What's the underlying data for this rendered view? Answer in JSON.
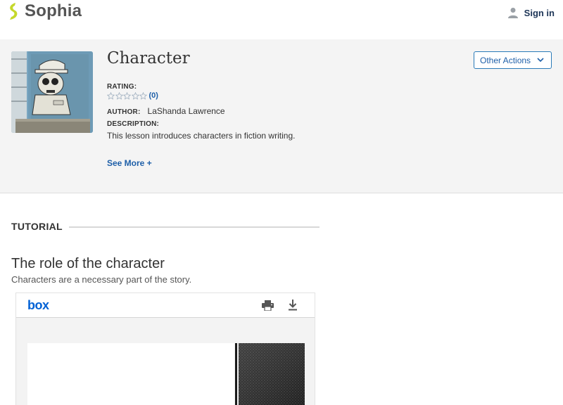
{
  "header": {
    "logo_text": "Sophia",
    "logo_icon": "sophia-s-logo-icon",
    "signin_label": "Sign in",
    "signin_icon": "person-icon"
  },
  "lesson": {
    "title": "Character",
    "rating_label": "RATING:",
    "rating_count": "(0)",
    "rating_value": 0,
    "rating_max": 5,
    "author_label": "AUTHOR:",
    "author_name": "LaShanda Lawrence",
    "description_label": "DESCRIPTION:",
    "description": "This lesson introduces characters in fiction writing.",
    "see_more": "See More +",
    "other_actions": "Other Actions",
    "thumbnail_icon": "cartoon-character-thumbnail"
  },
  "tutorial": {
    "heading": "TUTORIAL",
    "title": "The role of the character",
    "subtitle": "Characters are a necessary part of the story."
  },
  "box": {
    "logo": "box",
    "print_icon": "print-icon",
    "download_icon": "download-icon"
  },
  "colors": {
    "accent": "#1e5fa8",
    "logo_green": "#c5d82b",
    "box_blue": "#0061d5",
    "panel_bg": "#f4f4f4"
  }
}
